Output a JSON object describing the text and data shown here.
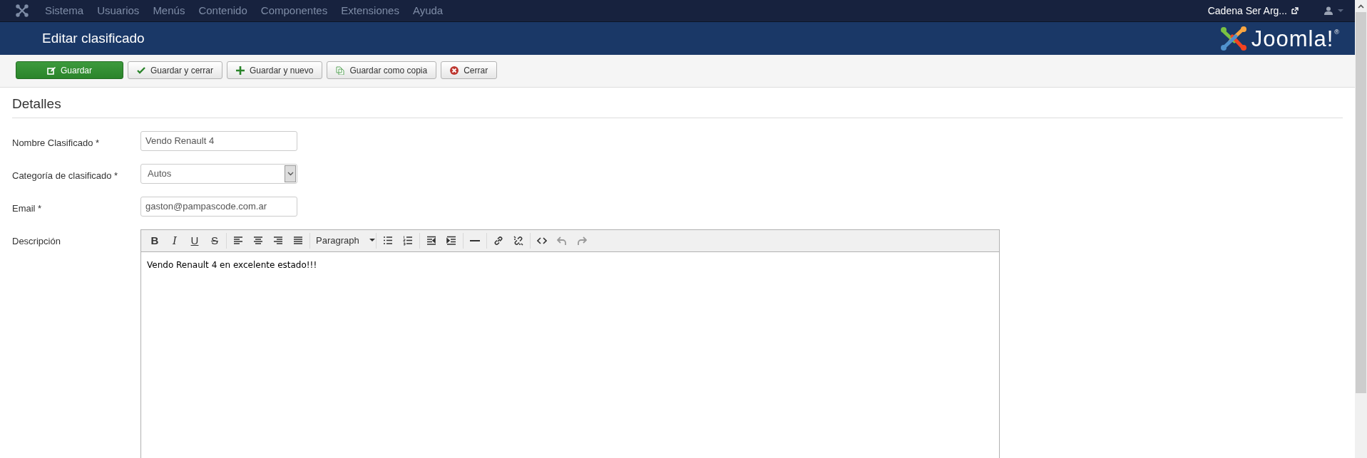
{
  "top_menu": {
    "items": [
      "Sistema",
      "Usuarios",
      "Menús",
      "Contenido",
      "Componentes",
      "Extensiones",
      "Ayuda"
    ],
    "site_link": "Cadena Ser Arg..."
  },
  "header": {
    "title": "Editar clasificado",
    "logo_text": "Joomla!",
    "logo_mark": "®"
  },
  "toolbar": [
    {
      "label": "Guardar",
      "kind": "save",
      "primary": true
    },
    {
      "label": "Guardar y cerrar",
      "kind": "check",
      "primary": false
    },
    {
      "label": "Guardar y nuevo",
      "kind": "plus",
      "primary": false
    },
    {
      "label": "Guardar como copia",
      "kind": "copy",
      "primary": false
    },
    {
      "label": "Cerrar",
      "kind": "close",
      "primary": false
    }
  ],
  "section_title": "Detalles",
  "fields": [
    {
      "kind": "text",
      "label": "Nombre Clasificado *",
      "value": "Vendo Renault 4"
    },
    {
      "kind": "select",
      "label": "Categoría de clasificado *",
      "value": "Autos"
    },
    {
      "kind": "text",
      "label": "Email *",
      "value": "gaston@pampascode.com.ar"
    },
    {
      "kind": "editor",
      "label": "Descripción",
      "content": "Vendo Renault 4 en excelente estado!!!",
      "editor_toolbar": [
        [
          {
            "kind": "bold",
            "label": "B",
            "disabled": false
          },
          {
            "kind": "italic",
            "label": "I",
            "disabled": false
          },
          {
            "kind": "underline",
            "label": "U",
            "disabled": false
          },
          {
            "kind": "strikethrough",
            "label": "S",
            "disabled": false
          }
        ],
        [
          {
            "kind": "alignleft",
            "disabled": false
          },
          {
            "kind": "aligncenter",
            "disabled": false
          },
          {
            "kind": "alignright",
            "disabled": false
          },
          {
            "kind": "alignjustify",
            "disabled": false
          }
        ],
        [
          {
            "kind": "format",
            "label": "Paragraph",
            "disabled": false
          }
        ],
        [
          {
            "kind": "bullist",
            "disabled": false
          },
          {
            "kind": "numlist",
            "disabled": false
          }
        ],
        [
          {
            "kind": "outdent",
            "disabled": false
          },
          {
            "kind": "indent",
            "disabled": false
          }
        ],
        [
          {
            "kind": "hr",
            "disabled": false
          }
        ],
        [
          {
            "kind": "link",
            "disabled": false
          },
          {
            "kind": "unlink",
            "disabled": false
          }
        ],
        [
          {
            "kind": "code",
            "disabled": false
          },
          {
            "kind": "undo",
            "disabled": true
          },
          {
            "kind": "redo",
            "disabled": true
          }
        ]
      ]
    }
  ]
}
